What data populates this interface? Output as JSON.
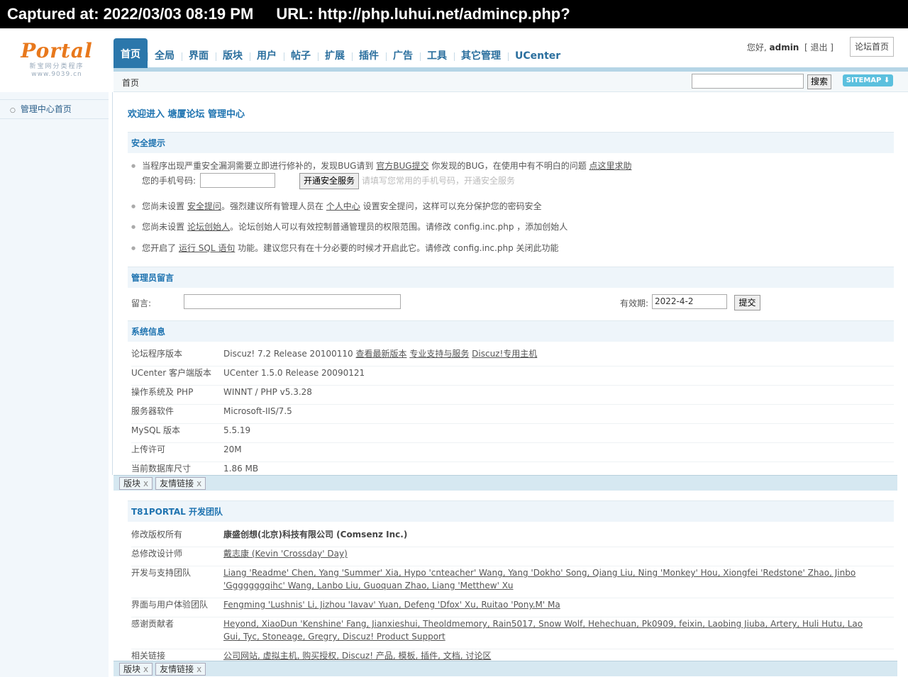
{
  "capture": {
    "captured_at": "Captured at: 2022/03/03 08:19 PM",
    "url": "URL: http://php.luhui.net/admincp.php?"
  },
  "logo": {
    "word": "Portal",
    "sub1": "新宝网分类程序",
    "sub2": "www.9039.cn"
  },
  "nav": {
    "tabs": [
      "首页",
      "全局",
      "界面",
      "版块",
      "用户",
      "帖子",
      "扩展",
      "插件",
      "广告",
      "工具",
      "其它管理",
      "UCenter"
    ],
    "active": "首页"
  },
  "user": {
    "greeting": "您好,",
    "name": "admin",
    "logout": "[ 退出 ]",
    "forum_home": "论坛首页"
  },
  "subbar": {
    "breadcrumb": "首页",
    "search_button": "搜索",
    "sitemap": "SITEMAP ⬇"
  },
  "sidebar": {
    "item": "管理中心首页"
  },
  "welcome": "欢迎进入 塘厦论坛 管理中心",
  "security": {
    "title": "安全提示",
    "tip1_a": "当程序出现严重安全漏洞需要立即进行修补的，发现BUG请到 ",
    "tip1_link1": "官方BUG提交",
    "tip1_b": " 你发现的BUG，在使用中有不明白的问题 ",
    "tip1_link2": "点这里求助",
    "phone_label": "您的手机号码:",
    "phone_button": "开通安全服务",
    "phone_hint": "请填写您常用的手机号码，开通安全服务",
    "tip2_a": "您尚未设置 ",
    "tip2_link1": "安全提问",
    "tip2_b": "。强烈建议所有管理人员在 ",
    "tip2_link2": "个人中心",
    "tip2_c": " 设置安全提问，这样可以充分保护您的密码安全",
    "tip3_a": "您尚未设置 ",
    "tip3_link": "论坛创始人",
    "tip3_b": "。论坛创始人可以有效控制普通管理员的权限范围。请修改 config.inc.php ，添加创始人",
    "tip4_a": "您开启了 ",
    "tip4_link": "运行 SQL 语句",
    "tip4_b": " 功能。建议您只有在十分必要的时候才开启此它。请修改 config.inc.php 关闭此功能"
  },
  "admin_msg": {
    "title": "管理员留言",
    "label": "留言:",
    "valid_label": "有效期:",
    "valid_value": "2022-4-2",
    "submit": "提交"
  },
  "sysinfo": {
    "title": "系统信息",
    "rows": [
      {
        "k": "论坛程序版本",
        "v": "Discuz! 7.2 Release 20100110",
        "links": [
          "查看最新版本",
          "专业支持与服务",
          "Discuz!专用主机"
        ]
      },
      {
        "k": "UCenter 客户端版本",
        "v": "UCenter 1.5.0 Release 20090121"
      },
      {
        "k": "操作系统及 PHP",
        "v": "WINNT / PHP v5.3.28"
      },
      {
        "k": "服务器软件",
        "v": "Microsoft-IIS/7.5"
      },
      {
        "k": "MySQL 版本",
        "v": "5.5.19"
      },
      {
        "k": "上传许可",
        "v": "20M"
      },
      {
        "k": "当前数据库尺寸",
        "v": "1.86 MB"
      }
    ]
  },
  "team": {
    "title": "T81PORTAL 开发团队",
    "rows": [
      {
        "k": "修改版权所有",
        "v": "康盛创想(北京)科技有限公司 (Comsenz Inc.)"
      },
      {
        "k": "总修改设计师",
        "v": "戴志康 (Kevin 'Crossday' Day)"
      },
      {
        "k": "开发与支持团队",
        "v": "Liang 'Readme' Chen, Yang 'Summer' Xia, Hypo 'cnteacher' Wang, Yang 'Dokho' Song, Qiang Liu, Ning 'Monkey' Hou, Xiongfei 'Redstone' Zhao, Jinbo 'Gggggggqihc' Wang, Lanbo Liu, Guoquan Zhao, Liang 'Metthew' Xu"
      },
      {
        "k": "界面与用户体验团队",
        "v": "Fengming 'Lushnis' Li, Jizhou 'Iavav' Yuan, Defeng 'Dfox' Xu, Ruitao 'Pony.M' Ma"
      },
      {
        "k": "感谢贡献者",
        "v": "Heyond, XiaoDun 'Kenshine' Fang, Jianxieshui, Theoldmemory, Rain5017, Snow Wolf, Hehechuan, Pk0909, feixin, Laobing Jiuba, Artery, Huli Hutu, Lao Gui, Tyc, Stoneage, Gregry, Discuz! Product Support"
      },
      {
        "k": "相关链接",
        "v": "公司网站, 虚拟主机, 购买授权, Discuz! 产品, 模板, 插件, 文档, 讨论区"
      }
    ]
  },
  "tray": {
    "chips": [
      "版块",
      "友情链接"
    ],
    "close": "x"
  }
}
